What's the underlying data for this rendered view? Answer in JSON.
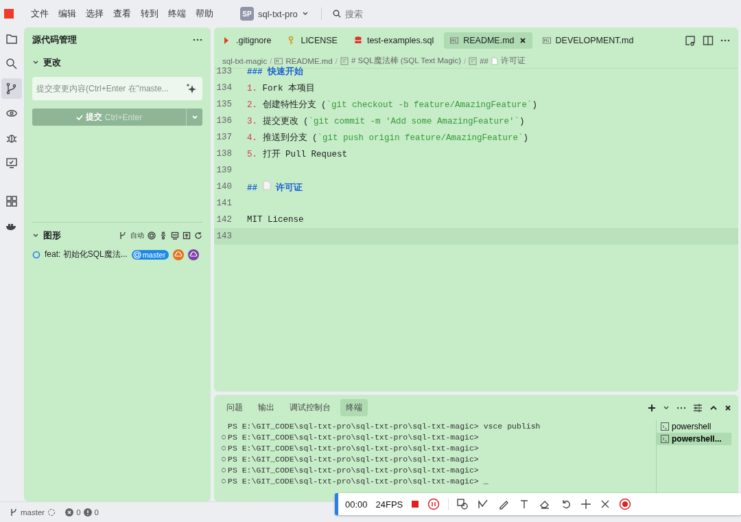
{
  "menu": [
    "文件",
    "编辑",
    "选择",
    "查看",
    "转到",
    "终端",
    "帮助"
  ],
  "project": {
    "initials": "SP",
    "name": "sql-txt-pro"
  },
  "search": {
    "placeholder": "搜索"
  },
  "activity_bar": [
    {
      "selected": false
    },
    {
      "selected": false
    },
    {
      "selected": true
    },
    {
      "selected": false
    },
    {
      "selected": false
    },
    {
      "selected": false
    },
    {
      "selected": false
    },
    {
      "selected": false
    }
  ],
  "sidebar": {
    "title": "源代码管理",
    "changes": {
      "title": "更改",
      "expanded": true
    },
    "commit_box": {
      "placeholder": "提交变更内容(Ctrl+Enter 在\"maste..."
    },
    "commit_button": {
      "label": "提交",
      "shortcut": "Ctrl+Enter",
      "disabled": true
    },
    "graph": {
      "title": "图形",
      "expanded": true,
      "hint": "自动",
      "commits": [
        {
          "message": "feat: 初始化SQL魔法...",
          "refs": [
            {
              "label": "master",
              "color": "#1e88e5"
            }
          ],
          "remotes": [
            {
              "color": "#e8711a"
            },
            {
              "color": "#7b3fa6"
            }
          ]
        }
      ]
    }
  },
  "tabs": [
    {
      "label": ".gitignore",
      "kind": "git",
      "selected": false
    },
    {
      "label": "LICENSE",
      "kind": "license",
      "selected": false
    },
    {
      "label": "test-examples.sql",
      "kind": "sql",
      "selected": false
    },
    {
      "label": "README.md",
      "kind": "markdown",
      "selected": true
    },
    {
      "label": "DEVELOPMENT.md",
      "kind": "markdown",
      "selected": false
    }
  ],
  "breadcrumb": {
    "separator": "/",
    "items": [
      "sql-txt-magic",
      "README.md",
      "# SQL魔法棒 (SQL Text Magic)",
      "##",
      "许可证"
    ]
  },
  "editor_lines": [
    {
      "number": "133",
      "segments": [
        {
          "kind": "heading",
          "text": "### 快速开始"
        }
      ]
    },
    {
      "number": "134",
      "segments": [
        {
          "kind": "marker",
          "text": "1. "
        },
        {
          "kind": "text",
          "text": "Fork 本项目"
        }
      ]
    },
    {
      "number": "135",
      "segments": [
        {
          "kind": "marker",
          "text": "2. "
        },
        {
          "kind": "text",
          "text": "创建特性分支 ("
        },
        {
          "kind": "code",
          "text": "`git checkout -b feature/AmazingFeature`"
        },
        {
          "kind": "text",
          "text": ")"
        }
      ]
    },
    {
      "number": "136",
      "segments": [
        {
          "kind": "marker",
          "text": "3. "
        },
        {
          "kind": "text",
          "text": "提交更改 ("
        },
        {
          "kind": "code",
          "text": "`git commit -m 'Add some AmazingFeature'`"
        },
        {
          "kind": "text",
          "text": ")"
        }
      ]
    },
    {
      "number": "137",
      "segments": [
        {
          "kind": "marker",
          "text": "4. "
        },
        {
          "kind": "text",
          "text": "推送到分支 ("
        },
        {
          "kind": "code",
          "text": "`git push origin feature/AmazingFeature`"
        },
        {
          "kind": "text",
          "text": ")"
        }
      ]
    },
    {
      "number": "138",
      "segments": [
        {
          "kind": "marker",
          "text": "5. "
        },
        {
          "kind": "text",
          "text": "打开 Pull Request"
        }
      ]
    },
    {
      "number": "139"
    },
    {
      "number": "140",
      "segments": [
        {
          "kind": "heading",
          "text": "## "
        },
        {
          "kind": "doc"
        },
        {
          "kind": "heading",
          "text": " 许可证"
        }
      ]
    },
    {
      "number": "141"
    },
    {
      "number": "142",
      "segments": [
        {
          "kind": "text",
          "text": "MIT License"
        }
      ]
    },
    {
      "number": "143",
      "current": true
    }
  ],
  "panel_tabs": [
    {
      "label": "问题",
      "selected": false
    },
    {
      "label": "输出",
      "selected": false
    },
    {
      "label": "调试控制台",
      "selected": false
    },
    {
      "label": "终端",
      "selected": true
    }
  ],
  "terminal_lines": [
    {
      "text": "PS E:\\GIT_CODE\\sql-txt-pro\\sql-txt-pro\\sql-txt-magic> vsce publish",
      "decorated": false
    },
    {
      "text": "PS E:\\GIT_CODE\\sql-txt-pro\\sql-txt-pro\\sql-txt-magic>",
      "decorated": true
    },
    {
      "text": "PS E:\\GIT_CODE\\sql-txt-pro\\sql-txt-pro\\sql-txt-magic>",
      "decorated": true
    },
    {
      "text": "PS E:\\GIT_CODE\\sql-txt-pro\\sql-txt-pro\\sql-txt-magic>",
      "decorated": true
    },
    {
      "text": "PS E:\\GIT_CODE\\sql-txt-pro\\sql-txt-pro\\sql-txt-magic>",
      "decorated": true
    },
    {
      "text": "PS E:\\GIT_CODE\\sql-txt-pro\\sql-txt-pro\\sql-txt-magic> _",
      "decorated": true
    }
  ],
  "terminals": [
    {
      "label": "powershell",
      "selected": false
    },
    {
      "label": "powershell...",
      "selected": true
    }
  ],
  "status_bar": {
    "branch": "master",
    "errors": "0",
    "warnings": "0"
  },
  "recorder": {
    "time": "00:00",
    "fps": "24FPS"
  }
}
